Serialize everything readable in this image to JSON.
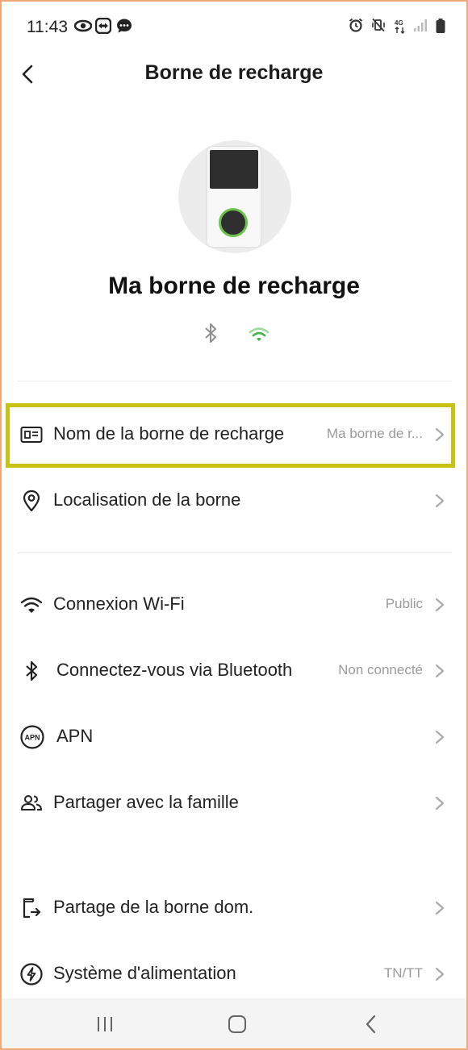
{
  "status_bar": {
    "time": "11:43",
    "left_icons": [
      "eye-icon",
      "teamviewer-icon",
      "message-icon"
    ],
    "right_icons": [
      "alarm-icon",
      "vibrate-mute-icon",
      "4g-icon",
      "signal-icon",
      "battery-icon"
    ],
    "network": "4G"
  },
  "header": {
    "title": "Borne de recharge",
    "back_icon": "back-arrow-icon"
  },
  "device": {
    "name": "Ma borne de recharge",
    "connectivity_icons": [
      "bluetooth-icon",
      "wifi-icon"
    ],
    "wifi_color": "#3cb84a",
    "bluetooth_color": "#8f8f8f"
  },
  "rows": [
    {
      "label": "Nom de la borne de recharge",
      "value": "Ma borne de r...",
      "icon": "id-card-icon",
      "highlighted": true
    },
    {
      "label": "Localisation de la borne",
      "value": "",
      "icon": "location-pin-icon"
    },
    {
      "label": "Connexion Wi-Fi",
      "value": "Public",
      "icon": "wifi-icon"
    },
    {
      "label": "Connectez-vous via Bluetooth",
      "value": "Non connecté",
      "icon": "bluetooth-icon"
    },
    {
      "label": "APN",
      "value": "",
      "icon": "apn-icon",
      "icon_text": "APN"
    },
    {
      "label": "Partager avec la famille",
      "value": "",
      "icon": "people-icon"
    },
    {
      "label": "Partage de la borne dom.",
      "value": "",
      "icon": "share-device-icon"
    },
    {
      "label": "Système d'alimentation",
      "value": "TN/TT",
      "icon": "power-system-icon"
    }
  ],
  "highlight_color": "#c8c313",
  "nav_bar": {
    "buttons": [
      "recent-apps-icon",
      "home-icon",
      "back-icon"
    ]
  }
}
